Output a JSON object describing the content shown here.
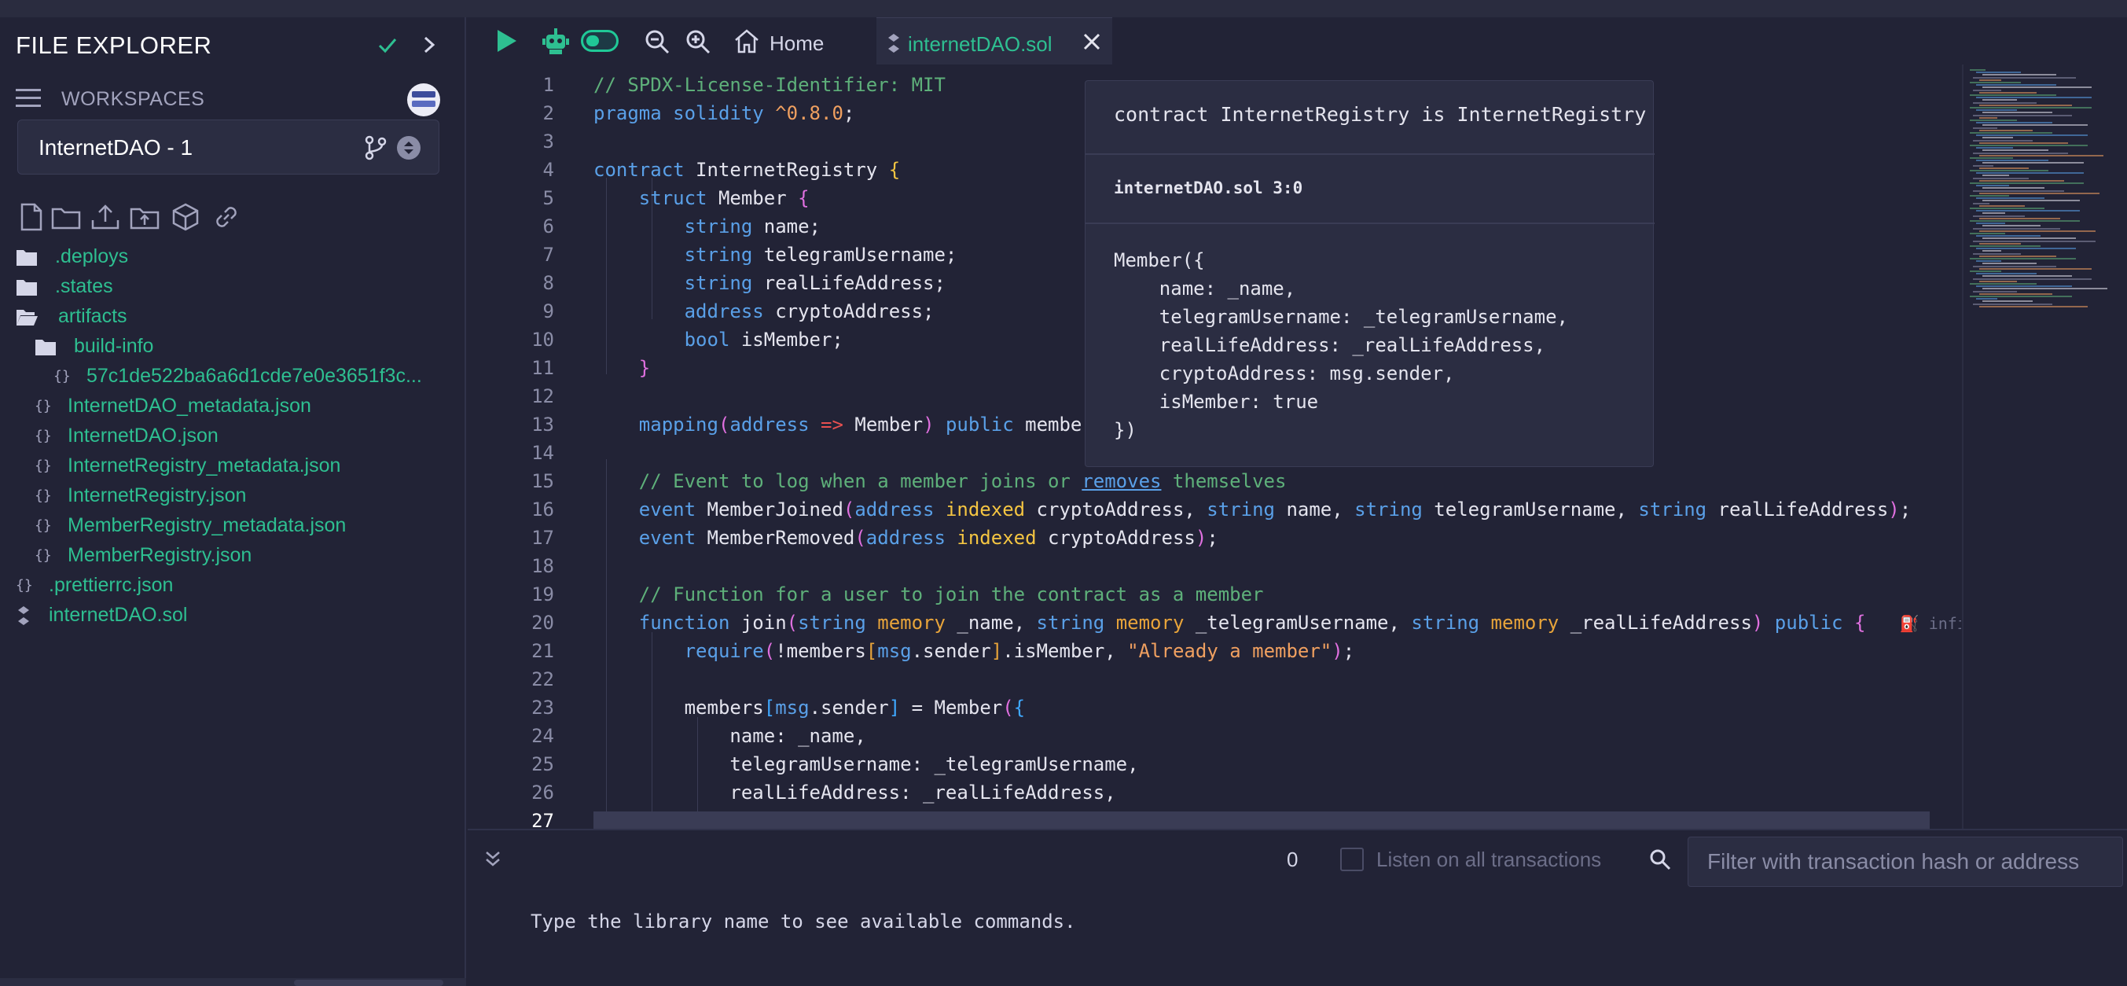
{
  "sidebar": {
    "title": "FILE EXPLORER",
    "workspaces_label": "WORKSPACES",
    "workspace_name": "InternetDAO - 1",
    "tree": [
      {
        "label": ".deploys",
        "type": "folder",
        "indent": 0
      },
      {
        "label": ".states",
        "type": "folder",
        "indent": 0
      },
      {
        "label": "artifacts",
        "type": "folder-open",
        "indent": 0
      },
      {
        "label": "build-info",
        "type": "folder",
        "indent": 1
      },
      {
        "label": "57c1de522ba6a6d1cde7e0e3651f3c...",
        "type": "json",
        "indent": 2
      },
      {
        "label": "InternetDAO_metadata.json",
        "type": "json",
        "indent": 1
      },
      {
        "label": "InternetDAO.json",
        "type": "json",
        "indent": 1
      },
      {
        "label": "InternetRegistry_metadata.json",
        "type": "json",
        "indent": 1
      },
      {
        "label": "InternetRegistry.json",
        "type": "json",
        "indent": 1
      },
      {
        "label": "MemberRegistry_metadata.json",
        "type": "json",
        "indent": 1
      },
      {
        "label": "MemberRegistry.json",
        "type": "json",
        "indent": 1
      },
      {
        "label": ".prettierrc.json",
        "type": "json",
        "indent": 0
      },
      {
        "label": "internetDAO.sol",
        "type": "sol",
        "indent": 0
      }
    ]
  },
  "tabs": {
    "home_label": "Home",
    "file_label": "internetDAO.sol"
  },
  "editor": {
    "line_numbers": [
      "1",
      "2",
      "3",
      "4",
      "5",
      "6",
      "7",
      "8",
      "9",
      "10",
      "11",
      "12",
      "13",
      "14",
      "15",
      "16",
      "17",
      "18",
      "19",
      "20",
      "21",
      "22",
      "23",
      "24",
      "25",
      "26",
      "27"
    ],
    "inline_hint": "infi"
  },
  "hover": {
    "signature": "contract InternetRegistry is InternetRegistry",
    "location": "internetDAO.sol 3:0",
    "body": "Member({\n    name: _name,\n    telegramUsername: _telegramUsername,\n    realLifeAddress: _realLifeAddress,\n    cryptoAddress: msg.sender,\n    isMember: true\n})"
  },
  "terminal": {
    "tx_count": "0",
    "listen_label": "Listen on all transactions",
    "filter_placeholder": "Filter with transaction hash or address",
    "message": "Type the library name to see available commands."
  },
  "colors": {
    "accent": "#2ebf91",
    "background": "#222336",
    "panel": "#2b2d42"
  }
}
